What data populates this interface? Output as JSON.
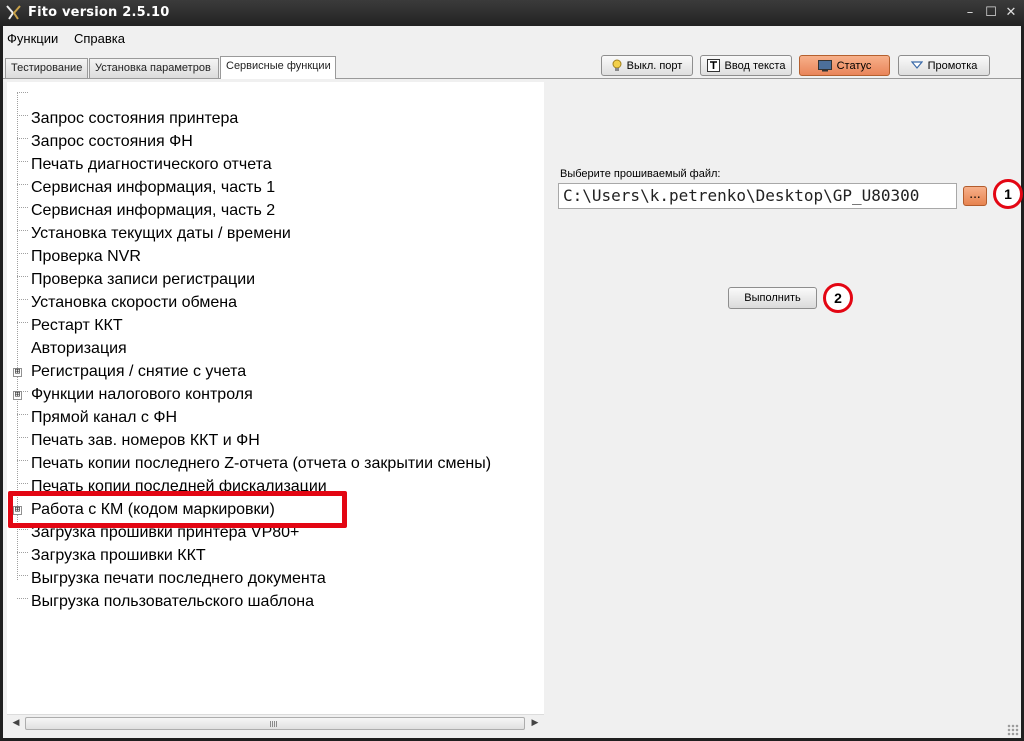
{
  "window": {
    "title": "Fito version 2.5.10",
    "minimize": "–",
    "maximize": "☐",
    "close": "✕"
  },
  "menu": [
    "Функции",
    "Справка"
  ],
  "tabs": [
    "Тестирование",
    "Установка параметров",
    "Сервисные функции"
  ],
  "toolbar": {
    "port_label": "Выкл. порт",
    "text_label": "Ввод текста",
    "status_label": "Статус",
    "feed_label": "Промотка"
  },
  "tree": [
    "Запрос состояния принтера",
    "Запрос состояния ФН",
    "Печать диагностического отчета",
    "Сервисная информация, часть 1",
    "Сервисная информация, часть 2",
    "Установка текущих даты / времени",
    "Проверка NVR",
    "Проверка записи регистрации",
    "Установка скорости обмена",
    "Рестарт ККТ",
    "Авторизация",
    "Регистрация / снятие с учета",
    "Функции налогового контроля",
    "Прямой канал с ФН",
    "Печать зав. номеров ККТ и ФН",
    "Печать копии последнего Z-отчета (отчета о закрытии смены)",
    "Печать копии последней фискализации",
    "Работа с КМ (кодом маркировки)",
    "Загрузка прошивки принтера VP80+",
    "Загрузка прошивки ККТ",
    "Выгрузка печати последнего документа",
    "Выгрузка пользовательского шаблона"
  ],
  "expanders": [
    "⊞",
    "⊞",
    "⊞"
  ],
  "right": {
    "file_label": "Выберите прошиваемый файл:",
    "file_path": "C:\\Users\\k.petrenko\\Desktop\\GP_U80300",
    "browse_label": "...",
    "execute_label": "Выполнить",
    "callout_1": "1",
    "callout_2": "2"
  },
  "accent": {
    "highlight": "#e30613",
    "orange_button": "#e9855a"
  }
}
